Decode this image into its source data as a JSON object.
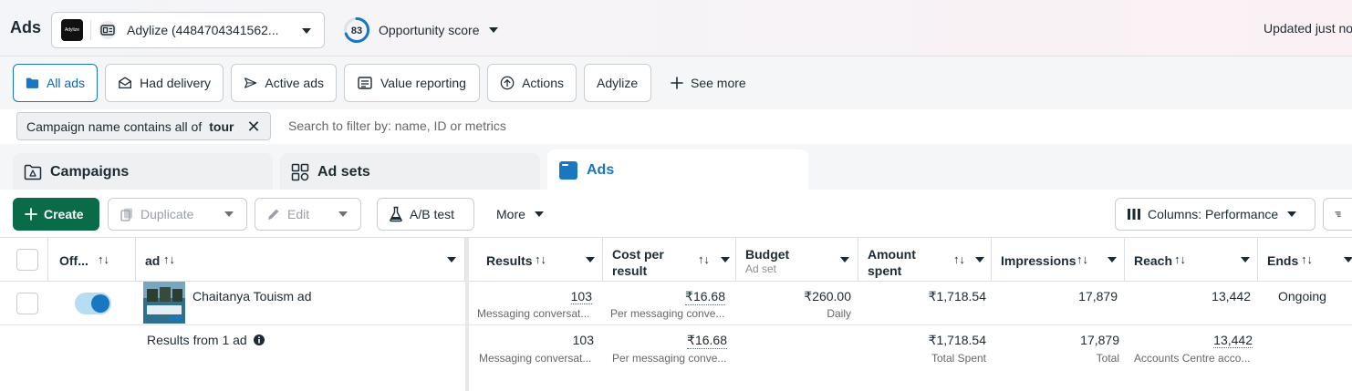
{
  "header": {
    "title": "Ads",
    "account_name": "Adylize (4484704341562...",
    "account_logo_text": "Adylize",
    "opportunity_score": "83",
    "opportunity_label": "Opportunity score",
    "updated_text": "Updated just no"
  },
  "filter_tabs": [
    {
      "label": "All ads",
      "icon": "folder-icon",
      "active": true
    },
    {
      "label": "Had delivery",
      "icon": "envelope-icon"
    },
    {
      "label": "Active ads",
      "icon": "send-icon"
    },
    {
      "label": "Value reporting",
      "icon": "report-icon"
    },
    {
      "label": "Actions",
      "icon": "upload-circle-icon"
    },
    {
      "label": "Adylize"
    },
    {
      "label": "See more",
      "icon": "plus-icon"
    }
  ],
  "search": {
    "chip_prefix": "Campaign name contains all of",
    "chip_value": "tour",
    "placeholder": "Search to filter by: name, ID or metrics"
  },
  "level_tabs": [
    {
      "label": "Campaigns",
      "icon": "campaign-icon"
    },
    {
      "label": "Ad sets",
      "icon": "grid-icon"
    },
    {
      "label": "Ads",
      "icon": "ad-window-icon",
      "active": true
    }
  ],
  "toolbar": {
    "create": "Create",
    "duplicate": "Duplicate",
    "edit": "Edit",
    "ab_test": "A/B test",
    "more": "More",
    "columns": "Columns: Performance"
  },
  "columns": {
    "off_on": "Off...",
    "ad": "ad",
    "results": "Results",
    "cost_per_result_1": "Cost per",
    "cost_per_result_2": "result",
    "budget": "Budget",
    "budget_sub": "Ad set",
    "amount_spent_1": "Amount",
    "amount_spent_2": "spent",
    "impressions": "Impressions",
    "reach": "Reach",
    "ends": "Ends"
  },
  "row": {
    "ad_name": "Chaitanya Touism ad",
    "results": "103",
    "results_sub": "Messaging conversat...",
    "cost_per_result": "₹16.68",
    "cost_sub": "Per messaging conve...",
    "budget": "₹260.00",
    "budget_sub": "Daily",
    "amount_spent": "₹1,718.54",
    "impressions": "17,879",
    "reach": "13,442",
    "ends": "Ongoing",
    "enabled": true
  },
  "summary": {
    "label": "Results from 1 ad",
    "results": "103",
    "results_sub": "Messaging conversat...",
    "cost_per_result": "₹16.68",
    "cost_sub": "Per messaging conve...",
    "amount_spent": "₹1,718.54",
    "amount_sub": "Total Spent",
    "impressions": "17,879",
    "impressions_sub": "Total",
    "reach": "13,442",
    "reach_sub": "Accounts Centre acco..."
  },
  "colors": {
    "accent_blue": "#1877c0",
    "create_green": "#0a6b49",
    "score_ring": "#1877c0"
  }
}
